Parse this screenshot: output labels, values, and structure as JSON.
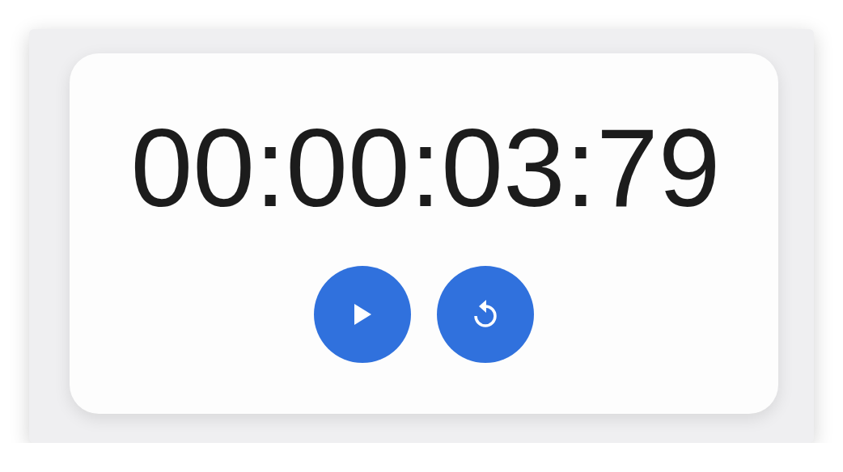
{
  "timer": {
    "display": "00:00:03:79"
  },
  "buttons": [
    {
      "kind": "play"
    },
    {
      "kind": "reset"
    }
  ]
}
